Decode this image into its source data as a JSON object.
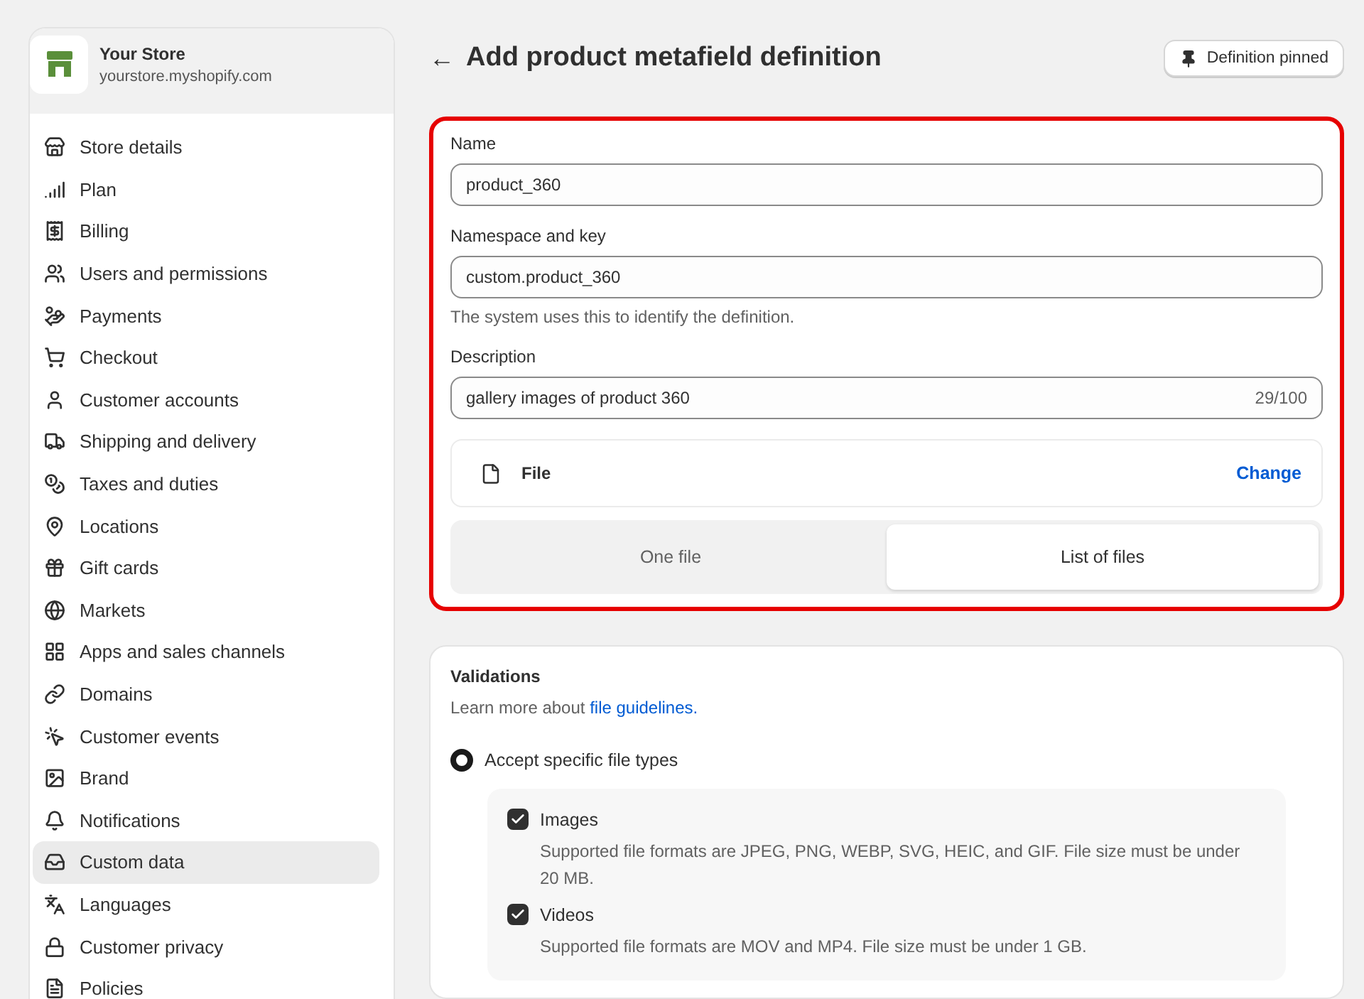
{
  "store": {
    "name": "Your Store",
    "domain": "yourstore.myshopify.com"
  },
  "sidebar": {
    "items": [
      {
        "label": "Store details",
        "selected": false
      },
      {
        "label": "Plan",
        "selected": false
      },
      {
        "label": "Billing",
        "selected": false
      },
      {
        "label": "Users and permissions",
        "selected": false
      },
      {
        "label": "Payments",
        "selected": false
      },
      {
        "label": "Checkout",
        "selected": false
      },
      {
        "label": "Customer accounts",
        "selected": false
      },
      {
        "label": "Shipping and delivery",
        "selected": false
      },
      {
        "label": "Taxes and duties",
        "selected": false
      },
      {
        "label": "Locations",
        "selected": false
      },
      {
        "label": "Gift cards",
        "selected": false
      },
      {
        "label": "Markets",
        "selected": false
      },
      {
        "label": "Apps and sales channels",
        "selected": false
      },
      {
        "label": "Domains",
        "selected": false
      },
      {
        "label": "Customer events",
        "selected": false
      },
      {
        "label": "Brand",
        "selected": false
      },
      {
        "label": "Notifications",
        "selected": false
      },
      {
        "label": "Custom data",
        "selected": true
      },
      {
        "label": "Languages",
        "selected": false
      },
      {
        "label": "Customer privacy",
        "selected": false
      },
      {
        "label": "Policies",
        "selected": false
      }
    ]
  },
  "header": {
    "back": "←",
    "title": "Add product metafield definition",
    "pinned_button": "Definition pinned"
  },
  "definition": {
    "name": {
      "label": "Name",
      "value": "product_360"
    },
    "namespace": {
      "label": "Namespace and key",
      "value": "custom.product_360",
      "help": "The system uses this to identify the definition."
    },
    "description": {
      "label": "Description",
      "value": "gallery images of product 360",
      "counter": "29/100"
    },
    "type": {
      "label": "File",
      "action": "Change"
    },
    "options": [
      {
        "label": "One file",
        "selected": false
      },
      {
        "label": "List of files",
        "selected": true
      }
    ]
  },
  "validations": {
    "title": "Validations",
    "intro": "Learn more about ",
    "link": "file guidelines.",
    "radio": {
      "label": "Accept specific file types",
      "selected": true
    },
    "file_types": [
      {
        "label": "Images",
        "checked": true,
        "help": "Supported file formats are JPEG, PNG, WEBP, SVG, HEIC, and GIF. File size must be under 20 MB."
      },
      {
        "label": "Videos",
        "checked": true,
        "help": "Supported file formats are MOV and MP4. File size must be under 1 GB."
      }
    ]
  }
}
